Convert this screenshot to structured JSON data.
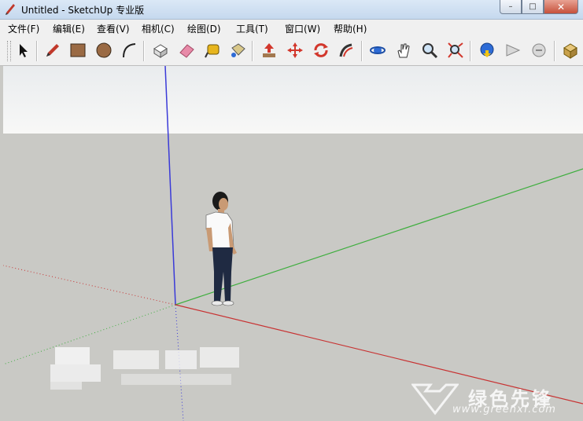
{
  "window": {
    "title": "Untitled - SketchUp 专业版",
    "controls": {
      "minimize": "–",
      "maximize": "□",
      "close": "✕"
    }
  },
  "menubar": {
    "items": [
      "文件(F)",
      "编辑(E)",
      "查看(V)",
      "相机(C)",
      "绘图(D)",
      "工具(T)",
      "窗口(W)",
      "帮助(H)"
    ]
  },
  "toolbar": {
    "tools": [
      "select",
      "pencil",
      "rectangle",
      "circle",
      "arc",
      "eraser-make-component",
      "paint-eraser",
      "tape-measure",
      "paint-bucket",
      "push-pull",
      "move",
      "rotate",
      "follow-me",
      "orbit",
      "pan",
      "zoom",
      "zoom-extents",
      "get-models",
      "share-model",
      "component",
      "warehouse"
    ]
  },
  "scene": {
    "colors": {
      "sky": "#f2f3f3",
      "ground": "#c9c9c5",
      "axis_red": "#c83232",
      "axis_green": "#3fae3f",
      "axis_blue": "#3a3ad8"
    }
  },
  "watermark": {
    "brand": "绿色先锋",
    "url": "www.greenxf.com"
  }
}
